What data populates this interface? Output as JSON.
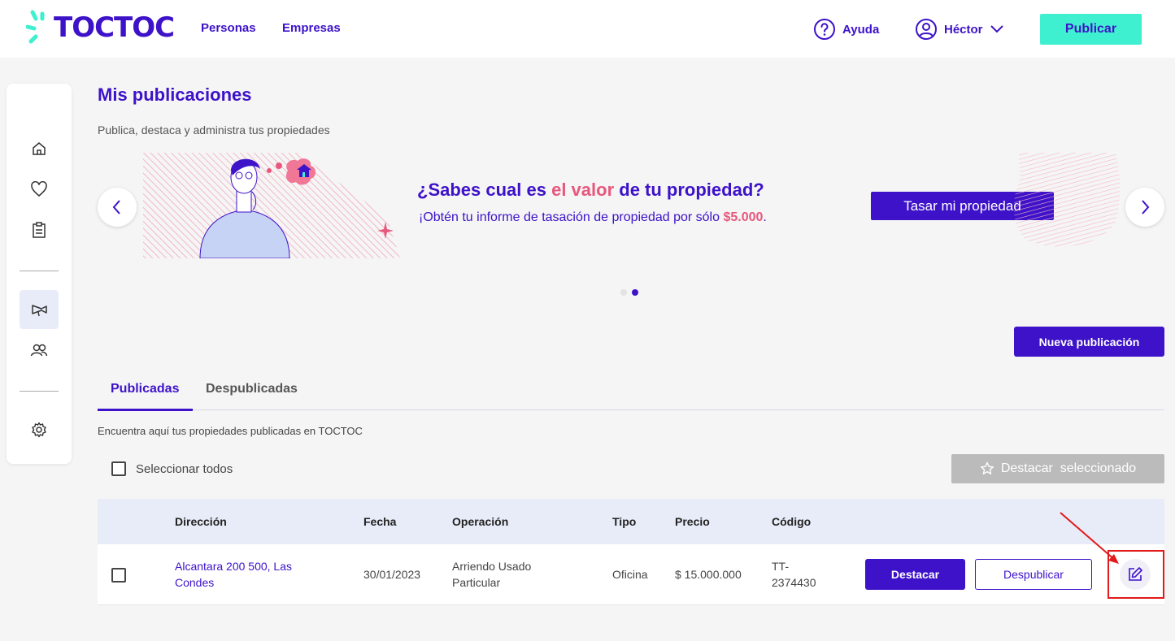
{
  "header": {
    "logo_text": "TOCTOC",
    "nav": [
      "Personas",
      "Empresas"
    ],
    "help_label": "Ayuda",
    "user_name": "Héctor",
    "publish_label": "Publicar"
  },
  "sidebar": {
    "icons": [
      "home-icon",
      "heart-icon",
      "clipboard-icon",
      "megaphone-icon",
      "users-icon",
      "gear-icon"
    ],
    "active": "megaphone-icon"
  },
  "page": {
    "title": "Mis publicaciones",
    "subtitle": "Publica, destaca y administra tus propiedades"
  },
  "banner": {
    "title_pre": "¿Sabes cual es ",
    "title_highlight": "el valor",
    "title_post": " de tu propiedad?",
    "text_pre": "¡Obtén tu informe de tasación de propiedad por sólo ",
    "text_highlight": "$5.000",
    "text_post": ".",
    "button_label": "Tasar mi propiedad",
    "slide_count": 2,
    "active_slide": 2
  },
  "actions": {
    "new_publication_label": "Nueva publicación",
    "feature_selected_label": "Destacar  seleccionado",
    "select_all_label": "Seleccionar todos"
  },
  "tabs": {
    "items": [
      "Publicadas",
      "Despublicadas"
    ],
    "active": "Publicadas",
    "description": "Encuentra aquí tus propiedades publicadas en TOCTOC"
  },
  "table": {
    "columns": [
      "Dirección",
      "Fecha",
      "Operación",
      "Tipo",
      "Precio",
      "Código"
    ],
    "rows": [
      {
        "address_line1": "Alcantara 200 500, Las",
        "address_line2": "Condes",
        "date": "30/01/2023",
        "operation_line1": "Arriendo Usado",
        "operation_line2": "Particular",
        "type": "Oficina",
        "price": "$ 15.000.000",
        "code_line1": "TT-",
        "code_line2": "2374430",
        "feature_label": "Destacar",
        "unpublish_label": "Despublicar"
      }
    ]
  },
  "colors": {
    "brand": "#3d12c9",
    "accent": "#3ff0d0",
    "highlight": "#e8577d",
    "annotation": "#e21a1a"
  }
}
